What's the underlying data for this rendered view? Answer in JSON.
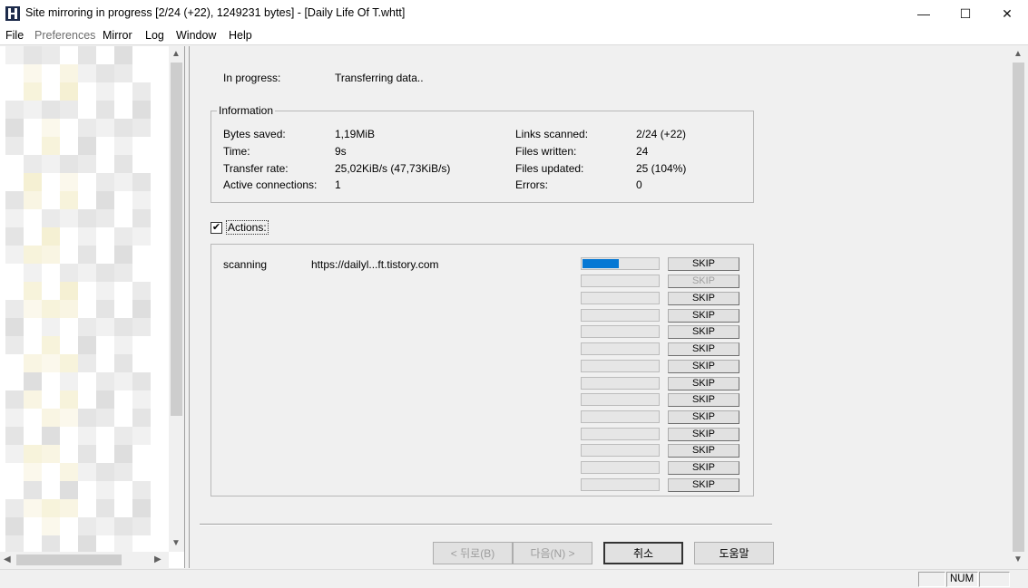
{
  "window": {
    "title": "Site mirroring in progress [2/24 (+22), 1249231 bytes] - [Daily Life Of T.whtt]",
    "icon": "httrack-h-icon",
    "controls": {
      "minimize": "—",
      "maximize": "☐",
      "close": "✕"
    }
  },
  "menu": {
    "items": [
      {
        "label": "File",
        "enabled": true
      },
      {
        "label": "Preferences",
        "enabled": false
      },
      {
        "label": "Mirror",
        "enabled": true
      },
      {
        "label": "Log",
        "enabled": true
      },
      {
        "label": "Window",
        "enabled": true
      },
      {
        "label": "Help",
        "enabled": true
      }
    ]
  },
  "progress": {
    "label": "In progress:",
    "value": "Transferring data.."
  },
  "information": {
    "title": "Information",
    "left": [
      {
        "label": "Bytes saved:",
        "value": "1,19MiB"
      },
      {
        "label": "Time:",
        "value": "9s"
      },
      {
        "label": "Transfer rate:",
        "value": "25,02KiB/s (47,73KiB/s)"
      },
      {
        "label": "Active connections:",
        "value": "1"
      }
    ],
    "right": [
      {
        "label": "Links scanned:",
        "value": "2/24 (+22)"
      },
      {
        "label": "Files written:",
        "value": "24"
      },
      {
        "label": "Files updated:",
        "value": "25 (104%)"
      },
      {
        "label": "Errors:",
        "value": "0"
      }
    ]
  },
  "actions": {
    "checkbox_label": "Actions:",
    "checked": true,
    "check_glyph": "✔",
    "rows": [
      {
        "status": "scanning",
        "url": "https://dailyl...ft.tistory.com",
        "progress": 0.48,
        "skip": "SKIP",
        "skip_enabled": true
      },
      {
        "status": "",
        "url": "",
        "progress": 0,
        "skip": "SKIP",
        "skip_enabled": false
      },
      {
        "status": "",
        "url": "",
        "progress": 0,
        "skip": "SKIP",
        "skip_enabled": true
      },
      {
        "status": "",
        "url": "",
        "progress": 0,
        "skip": "SKIP",
        "skip_enabled": true
      },
      {
        "status": "",
        "url": "",
        "progress": 0,
        "skip": "SKIP",
        "skip_enabled": true
      },
      {
        "status": "",
        "url": "",
        "progress": 0,
        "skip": "SKIP",
        "skip_enabled": true
      },
      {
        "status": "",
        "url": "",
        "progress": 0,
        "skip": "SKIP",
        "skip_enabled": true
      },
      {
        "status": "",
        "url": "",
        "progress": 0,
        "skip": "SKIP",
        "skip_enabled": true
      },
      {
        "status": "",
        "url": "",
        "progress": 0,
        "skip": "SKIP",
        "skip_enabled": true
      },
      {
        "status": "",
        "url": "",
        "progress": 0,
        "skip": "SKIP",
        "skip_enabled": true
      },
      {
        "status": "",
        "url": "",
        "progress": 0,
        "skip": "SKIP",
        "skip_enabled": true
      },
      {
        "status": "",
        "url": "",
        "progress": 0,
        "skip": "SKIP",
        "skip_enabled": true
      },
      {
        "status": "",
        "url": "",
        "progress": 0,
        "skip": "SKIP",
        "skip_enabled": true
      },
      {
        "status": "",
        "url": "",
        "progress": 0,
        "skip": "SKIP",
        "skip_enabled": true
      }
    ]
  },
  "buttons": {
    "back": "< 뒤로(B)",
    "next": "다음(N) >",
    "cancel": "취소",
    "help": "도움말"
  },
  "statusbar": {
    "num": "NUM"
  },
  "scroll_arrows": {
    "up": "▲",
    "down": "▼",
    "left": "◀",
    "right": "▶"
  },
  "colors": {
    "progress_fill": "#0678d4",
    "tree_blur_a": "#f3ecc8",
    "tree_blur_b": "#d6d6d6"
  }
}
